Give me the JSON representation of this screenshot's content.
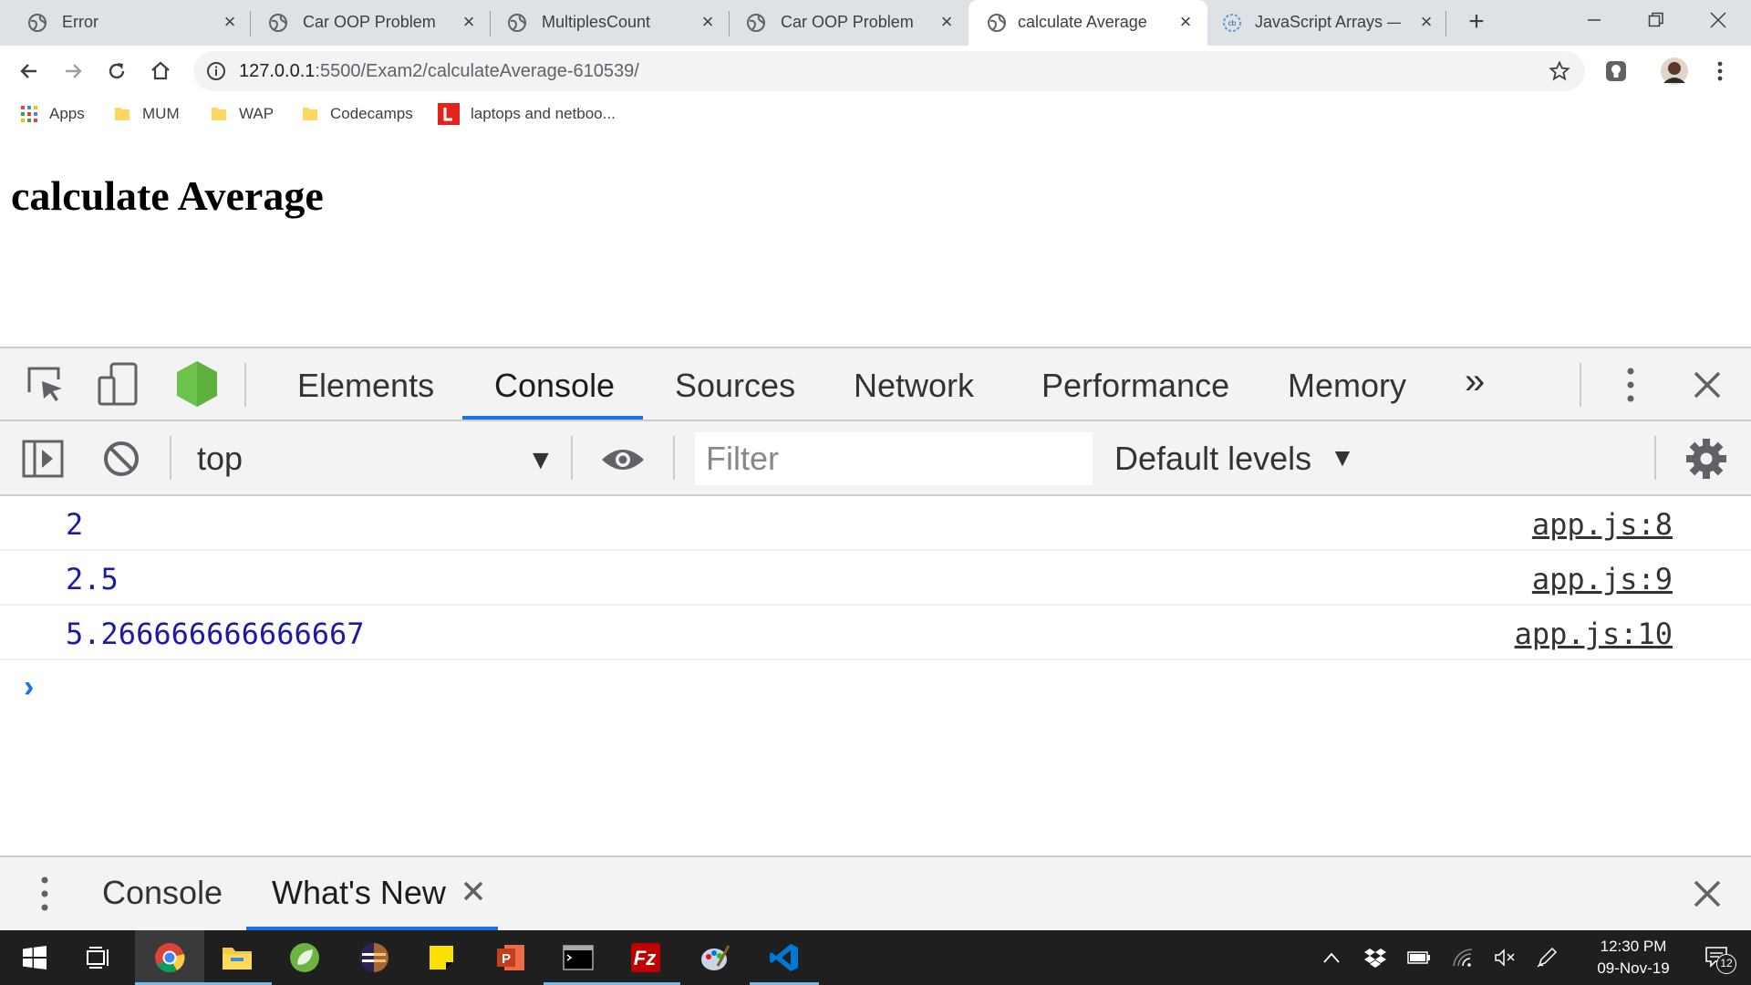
{
  "browser": {
    "tabs": [
      {
        "title": "Error",
        "active": false
      },
      {
        "title": "Car OOP Problem",
        "active": false
      },
      {
        "title": "MultiplesCount",
        "active": false
      },
      {
        "title": "Car OOP Problem",
        "active": false
      },
      {
        "title": "calculate Average",
        "active": true
      },
      {
        "title": "JavaScript Arrays — I",
        "active": false
      }
    ],
    "new_tab_label": "+",
    "url_host": "127.0.0.1",
    "url_rest": ":5500/Exam2/calculateAverage-610539/",
    "bookmarks": [
      {
        "label": "Apps",
        "icon": "apps-grid-icon"
      },
      {
        "label": "MUM",
        "icon": "folder-icon"
      },
      {
        "label": "WAP",
        "icon": "folder-icon"
      },
      {
        "label": "Codecamps",
        "icon": "folder-icon"
      },
      {
        "label": "laptops and netboo...",
        "icon": "lenovo-icon"
      }
    ]
  },
  "page": {
    "heading": "calculate Average"
  },
  "devtools": {
    "tabs": [
      "Elements",
      "Console",
      "Sources",
      "Network",
      "Performance",
      "Memory"
    ],
    "active_tab": "Console",
    "more_tabs": "»",
    "context": "top",
    "filter_placeholder": "Filter",
    "levels": "Default levels",
    "messages": [
      {
        "value": "2",
        "source": "app.js:8"
      },
      {
        "value": "2.5",
        "source": "app.js:9"
      },
      {
        "value": "5.266666666666667",
        "source": "app.js:10"
      }
    ],
    "prompt": "›",
    "drawer_tabs": [
      {
        "label": "Console",
        "active": false
      },
      {
        "label": "What's New",
        "active": true,
        "closable": true
      }
    ],
    "drawer_close": "×"
  },
  "taskbar": {
    "time": "12:30 PM",
    "date": "09-Nov-19",
    "notifications": "12"
  },
  "colors": {
    "accent": "#1a73e8",
    "console_value": "#1a1aa6",
    "tab_strip": "#dee1e6",
    "devtools_bg": "#f3f3f3",
    "taskbar": "#1f1f1f"
  }
}
